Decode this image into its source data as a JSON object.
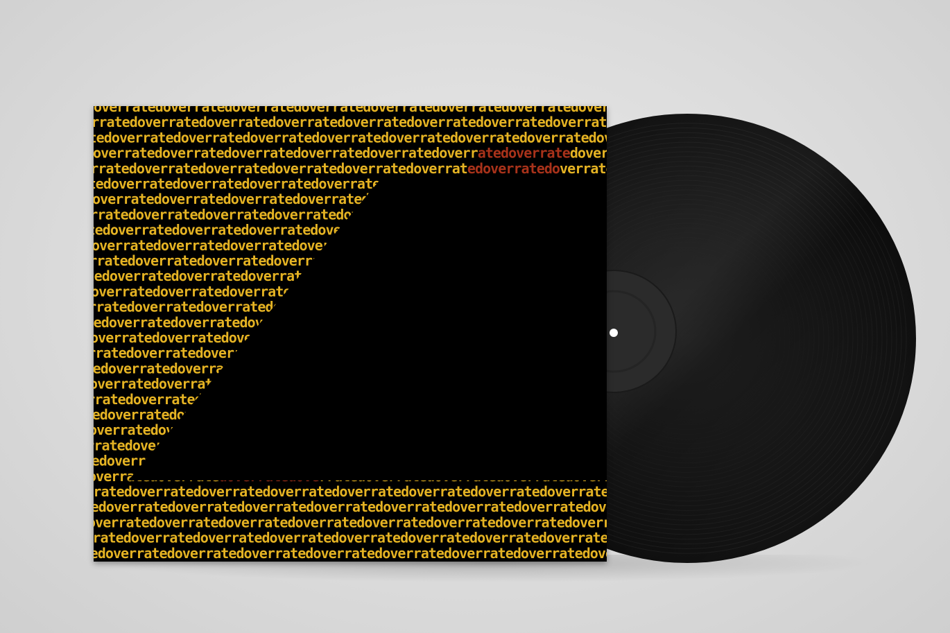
{
  "cover": {
    "text": "overrated",
    "row_count": 30,
    "colors": {
      "background": "#000000",
      "text_primary": "#e5b323",
      "text_accent": "#a8321a"
    }
  },
  "record": {
    "colors": {
      "vinyl": "#141414",
      "label": "#2a2a2a",
      "spindle_hole": "#ffffff"
    }
  },
  "scene": {
    "colors": {
      "backdrop": "#dcdcdc"
    }
  }
}
